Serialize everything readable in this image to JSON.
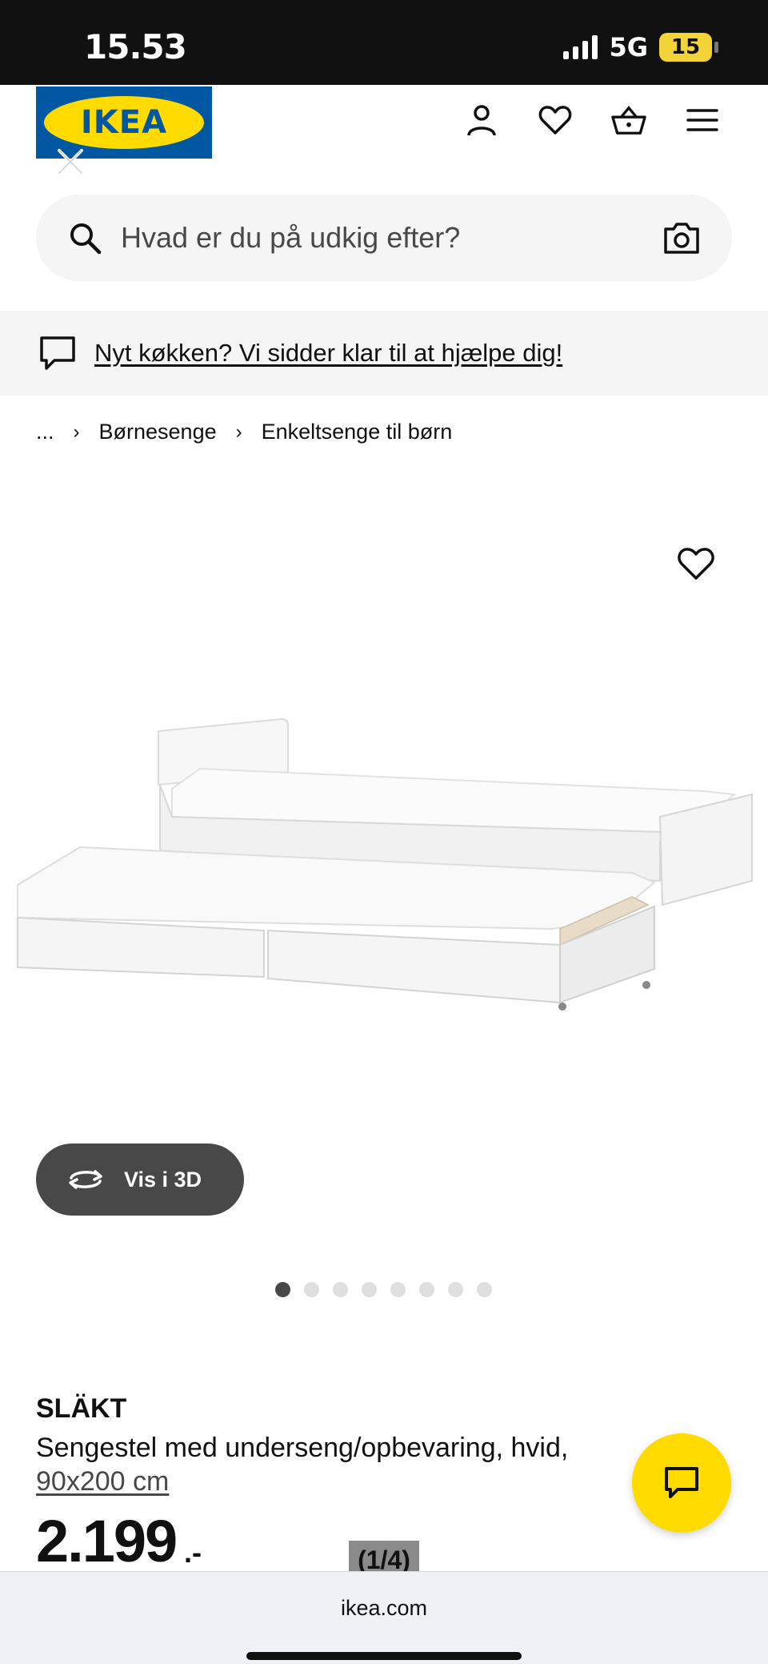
{
  "status_bar": {
    "time": "15.53",
    "network": "5G",
    "battery": "15"
  },
  "header": {
    "logo_text": "IKEA",
    "icons": [
      "user-icon",
      "heart-icon",
      "basket-icon",
      "menu-icon"
    ]
  },
  "search": {
    "placeholder": "Hvad er du på udkig efter?"
  },
  "banner": {
    "link_text": "Nyt køkken? Vi sidder klar til at hjælpe dig!"
  },
  "breadcrumb": {
    "items": [
      "...",
      "Børnesenge",
      "Enkeltsenge til børn"
    ],
    "separator": "›"
  },
  "gallery": {
    "view_3d_label": "Vis i 3D",
    "dot_count": 8,
    "active_dot": 0,
    "counter": "(1/4)"
  },
  "product": {
    "name": "SLÄKT",
    "description": "Sengestel med underseng/opbevaring, hvid,",
    "size": "90x200 cm",
    "price": "2.199",
    "price_suffix": ".-"
  },
  "browser": {
    "url": "ikea.com"
  },
  "colors": {
    "ikea_blue": "#0058a3",
    "ikea_yellow": "#ffdb00",
    "dark_grey": "#484848"
  }
}
